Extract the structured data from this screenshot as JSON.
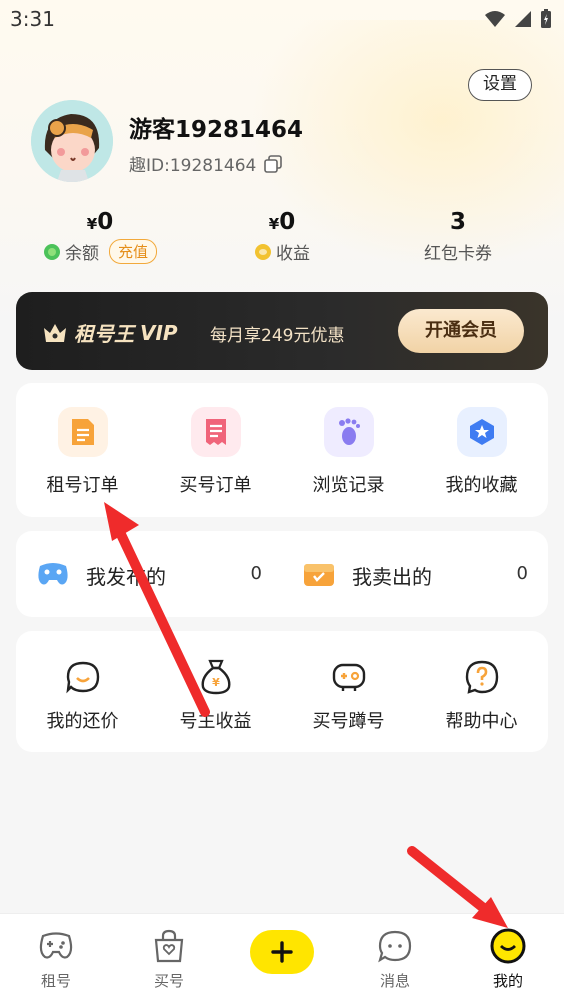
{
  "status": {
    "time": "3:31"
  },
  "header": {
    "settings_label": "设置"
  },
  "profile": {
    "name": "游客19281464",
    "id_text": "趣ID:19281464"
  },
  "stats": [
    {
      "currency": "¥",
      "value": "0",
      "label": "余额",
      "action": "充值"
    },
    {
      "currency": "¥",
      "value": "0",
      "label": "收益"
    },
    {
      "currency": "",
      "value": "3",
      "label": "红包卡券"
    }
  ],
  "vip": {
    "brand": "租号王",
    "vip_text": "VIP",
    "offer": "每月享249元优惠",
    "button": "开通会员"
  },
  "orders": [
    {
      "label": "租号订单",
      "icon": "order-doc-icon",
      "color": "#f7a33a"
    },
    {
      "label": "买号订单",
      "icon": "receipt-icon",
      "color": "#f0647a"
    },
    {
      "label": "浏览记录",
      "icon": "footprint-icon",
      "color": "#8a7cf0"
    },
    {
      "label": "我的收藏",
      "icon": "star-icon",
      "color": "#3f7cf2"
    }
  ],
  "sold": [
    {
      "label": "我发布的",
      "count": "0",
      "icon": "gamepad-icon"
    },
    {
      "label": "我卖出的",
      "count": "0",
      "icon": "box-icon"
    }
  ],
  "tools": [
    {
      "label": "我的还价",
      "icon": "chat-smile-icon"
    },
    {
      "label": "号主收益",
      "icon": "money-bag-icon"
    },
    {
      "label": "买号蹲号",
      "icon": "game-controller-icon"
    },
    {
      "label": "帮助中心",
      "icon": "help-icon"
    }
  ],
  "tabs": [
    {
      "label": "租号",
      "icon": "gamepad-tab-icon"
    },
    {
      "label": "买号",
      "icon": "shopping-bag-icon"
    },
    {
      "label": "",
      "icon": "plus-icon"
    },
    {
      "label": "消息",
      "icon": "message-icon"
    },
    {
      "label": "我的",
      "icon": "me-smile-icon"
    }
  ],
  "colors": {
    "accent": "#ffe500",
    "vip_bg": "#1e1e1e",
    "recharge": "#e58e1a"
  }
}
